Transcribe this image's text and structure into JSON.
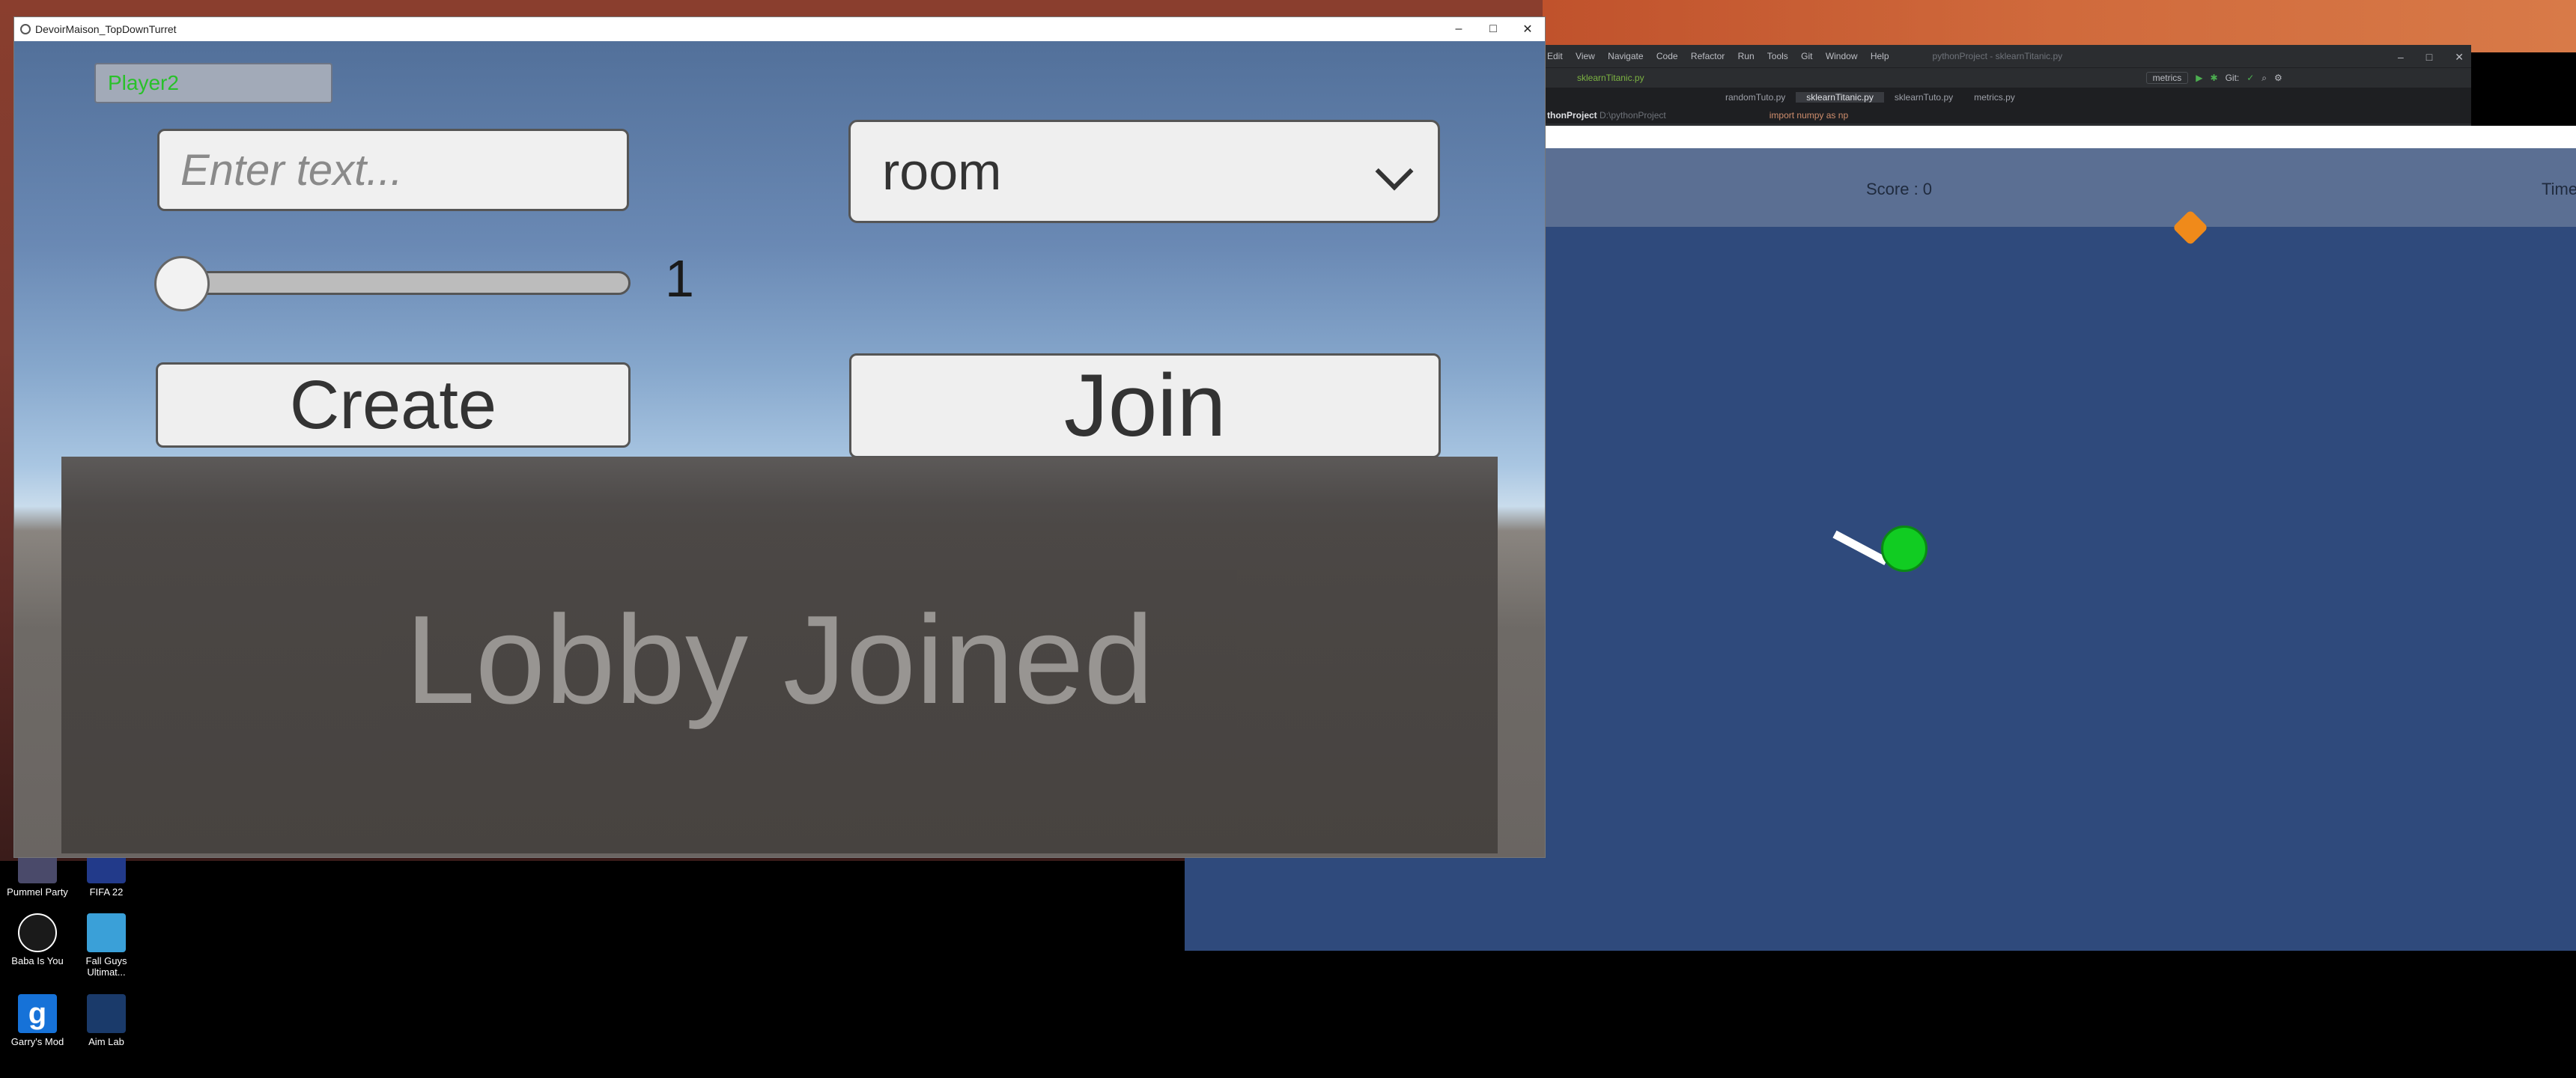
{
  "desktop": {
    "icons": [
      {
        "label": "Pummel Party",
        "color": "#4a4a6a"
      },
      {
        "label": "FIFA 22",
        "color": "#223a8a"
      },
      {
        "label": "Baba Is You",
        "color": "#1a1a1a"
      },
      {
        "label": "Fall Guys Ultimat...",
        "color": "#3aa0d8"
      },
      {
        "label": "Garry's Mod",
        "color": "#1672d8"
      },
      {
        "label": "Aim Lab",
        "color": "#1a3a6a"
      }
    ]
  },
  "ide": {
    "menu": [
      "Edit",
      "View",
      "Navigate",
      "Code",
      "Refactor",
      "Run",
      "Tools",
      "Git",
      "Window",
      "Help"
    ],
    "project_title": "pythonProject - sklearnTitanic.py",
    "file_crumb": "sklearnTitanic.py",
    "run_config": "metrics",
    "tabs": [
      "randomTuto.py",
      "sklearnTitanic.py",
      "sklearnTuto.py",
      "metrics.py"
    ],
    "active_tab": 1,
    "crumb_project": "thonProject",
    "crumb_path": "D:\\pythonProject",
    "code_line": "import numpy as np"
  },
  "game": {
    "score_text": "Score : 0",
    "timer_text": "Time"
  },
  "lobby_window": {
    "title": "DevoirMaison_TopDownTurret",
    "player_name": "Player2",
    "text_input_placeholder": "Enter text...",
    "dropdown_value": "room",
    "slider_value": "1",
    "slider_fraction": 0,
    "create_label": "Create",
    "join_label": "Join",
    "status_text": "Lobby Joined"
  },
  "colors": {
    "player_name": "#29c12a",
    "player_dot": "#11cc22",
    "gem": "#f08a1a",
    "game_bg": "#2f4a7c"
  }
}
